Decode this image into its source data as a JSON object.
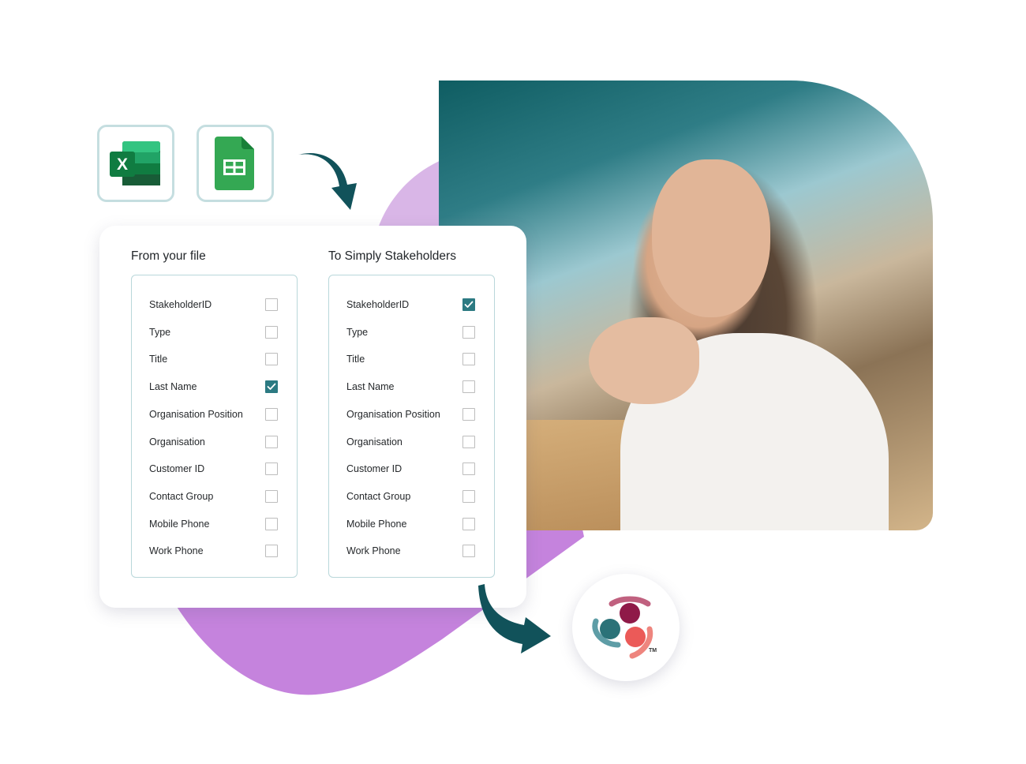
{
  "source_apps": [
    {
      "name": "Microsoft Excel",
      "icon": "excel-icon"
    },
    {
      "name": "Google Sheets",
      "icon": "google-sheets-icon"
    }
  ],
  "mapping_card": {
    "left_column": {
      "title": "From your file",
      "fields": [
        {
          "label": "StakeholderID",
          "checked": false
        },
        {
          "label": "Type",
          "checked": false
        },
        {
          "label": "Title",
          "checked": false
        },
        {
          "label": "Last Name",
          "checked": true
        },
        {
          "label": "Organisation Position",
          "checked": false
        },
        {
          "label": "Organisation",
          "checked": false
        },
        {
          "label": "Customer ID",
          "checked": false
        },
        {
          "label": "Contact Group",
          "checked": false
        },
        {
          "label": "Mobile Phone",
          "checked": false
        },
        {
          "label": "Work Phone",
          "checked": false
        }
      ]
    },
    "right_column": {
      "title": "To Simply Stakeholders",
      "fields": [
        {
          "label": "StakeholderID",
          "checked": true
        },
        {
          "label": "Type",
          "checked": false
        },
        {
          "label": "Title",
          "checked": false
        },
        {
          "label": "Last Name",
          "checked": false
        },
        {
          "label": "Organisation Position",
          "checked": false
        },
        {
          "label": "Organisation",
          "checked": false
        },
        {
          "label": "Customer ID",
          "checked": false
        },
        {
          "label": "Contact Group",
          "checked": false
        },
        {
          "label": "Mobile Phone",
          "checked": false
        },
        {
          "label": "Work Phone",
          "checked": false
        }
      ]
    }
  },
  "destination_logo": {
    "name": "Simply Stakeholders logo",
    "trademark": "TM"
  },
  "photo": {
    "description": "Smiling woman seated at a desk with clasped hands"
  },
  "colors": {
    "accent_teal": "#11525a",
    "checkbox_checked": "#2c7a82",
    "purple_blob": "#c583dd",
    "purple_blob_light": "#d9b6e7",
    "tile_border": "#c5dee0"
  }
}
